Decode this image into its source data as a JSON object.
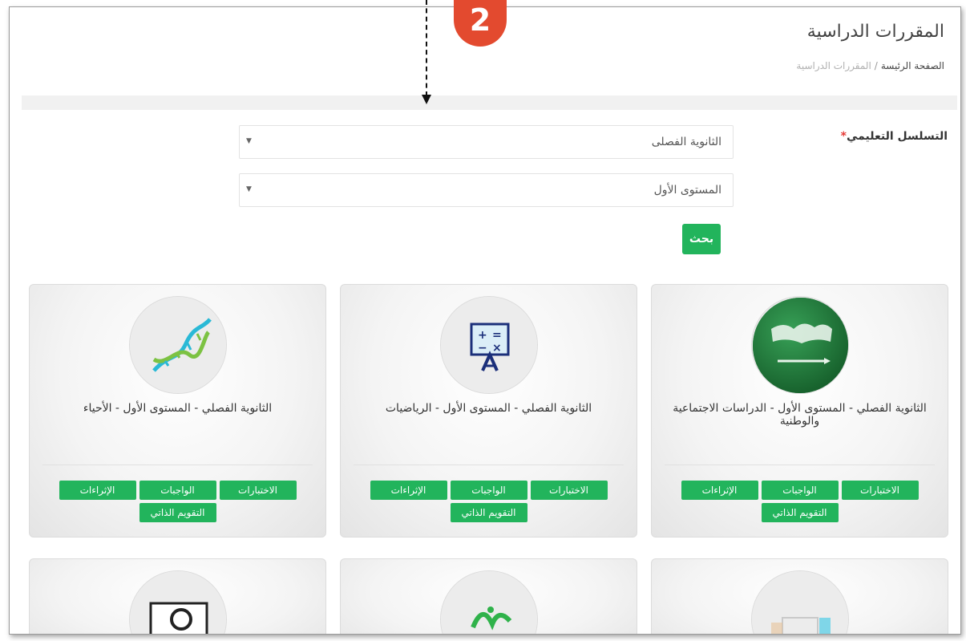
{
  "header": {
    "title": "المقررات الدراسية",
    "breadcrumb_home": "الصفحة الرئيسة",
    "breadcrumb_sep": "/",
    "breadcrumb_current": "المقررات الدراسية"
  },
  "filter": {
    "label": "التسلسل التعليمي",
    "required_mark": "*",
    "select1_value": "الثانوية الفصلى",
    "select2_value": "المستوى الأول",
    "caret": "▼",
    "search_label": "بحث"
  },
  "callout": {
    "number": "2"
  },
  "courses": [
    {
      "title": "الثانوية الفصلي - المستوى الأول - الدراسات الاجتماعية والوطنية",
      "icon": "saudi-flag-icon",
      "buttons": [
        "الاختبارات",
        "الواجبات",
        "الإثراءات",
        "التقويم الذاتي"
      ]
    },
    {
      "title": "الثانوية الفصلي - المستوى الأول - الرياضيات",
      "icon": "math-board-icon",
      "buttons": [
        "الاختبارات",
        "الواجبات",
        "الإثراءات",
        "التقويم الذاتي"
      ]
    },
    {
      "title": "الثانوية الفصلي - المستوى الأول - الأحياء",
      "icon": "dna-icon",
      "buttons": [
        "الاختبارات",
        "الواجبات",
        "الإثراءات",
        "التقويم الذاتي"
      ]
    }
  ],
  "colors": {
    "accent": "#22b45c",
    "callout": "#e34a2f"
  }
}
